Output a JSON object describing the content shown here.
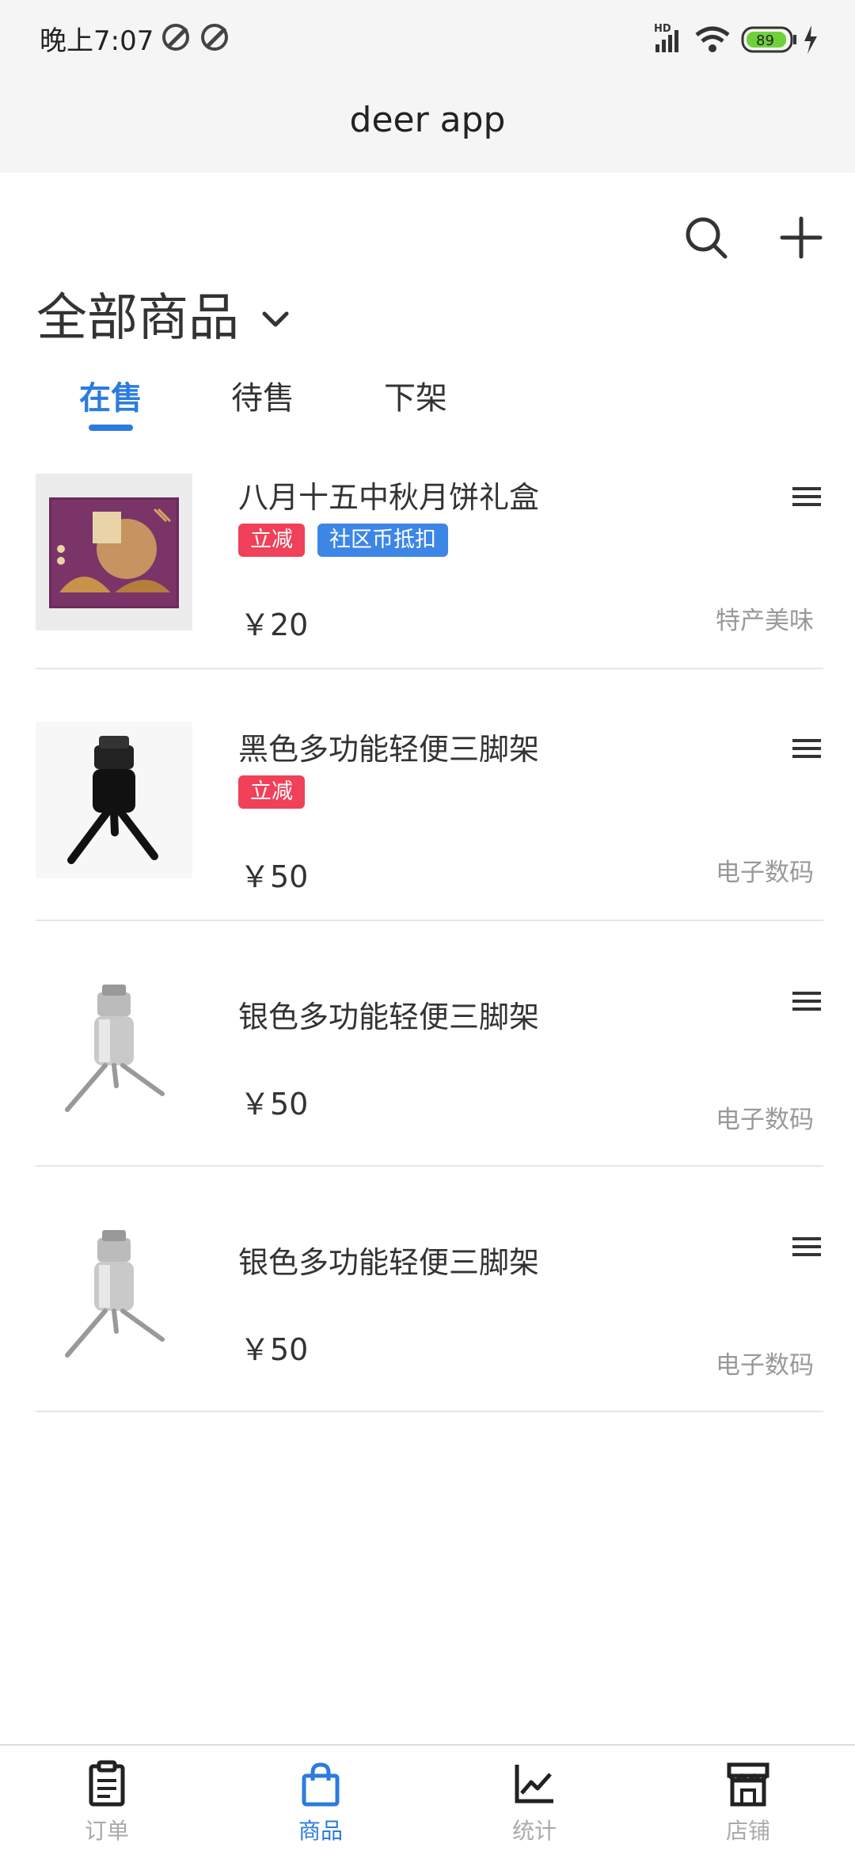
{
  "status_bar": {
    "time": "晚上7:07",
    "network": "HD",
    "battery": "89"
  },
  "app_bar": {
    "title": "deer app"
  },
  "header": {
    "section_title": "全部商品",
    "search_icon": "search-icon",
    "add_icon": "plus-icon",
    "dropdown_icon": "chevron-down-icon"
  },
  "tabs": [
    {
      "label": "在售",
      "active": true
    },
    {
      "label": "待售",
      "active": false
    },
    {
      "label": "下架",
      "active": false
    }
  ],
  "products": [
    {
      "name": "八月十五中秋月饼礼盒",
      "tags": [
        "立减",
        "社区币抵扣"
      ],
      "price": "￥20",
      "category": "特产美味",
      "image": "mooncake-box"
    },
    {
      "name": "黑色多功能轻便三脚架",
      "tags": [
        "立减"
      ],
      "price": "￥50",
      "category": "电子数码",
      "image": "black-tripod"
    },
    {
      "name": "银色多功能轻便三脚架",
      "tags": [],
      "price": "￥50",
      "category": "电子数码",
      "image": "silver-tripod"
    },
    {
      "name": "银色多功能轻便三脚架",
      "tags": [],
      "price": "￥50",
      "category": "电子数码",
      "image": "silver-tripod"
    }
  ],
  "bottom_nav": [
    {
      "label": "订单",
      "icon": "clipboard-icon",
      "active": false
    },
    {
      "label": "商品",
      "icon": "shopping-bag-icon",
      "active": true
    },
    {
      "label": "统计",
      "icon": "line-chart-icon",
      "active": false
    },
    {
      "label": "店铺",
      "icon": "store-icon",
      "active": false
    }
  ],
  "colors": {
    "accent": "#2b7be0",
    "tag_red": "#f0405a",
    "tag_blue": "#3d86e6"
  }
}
